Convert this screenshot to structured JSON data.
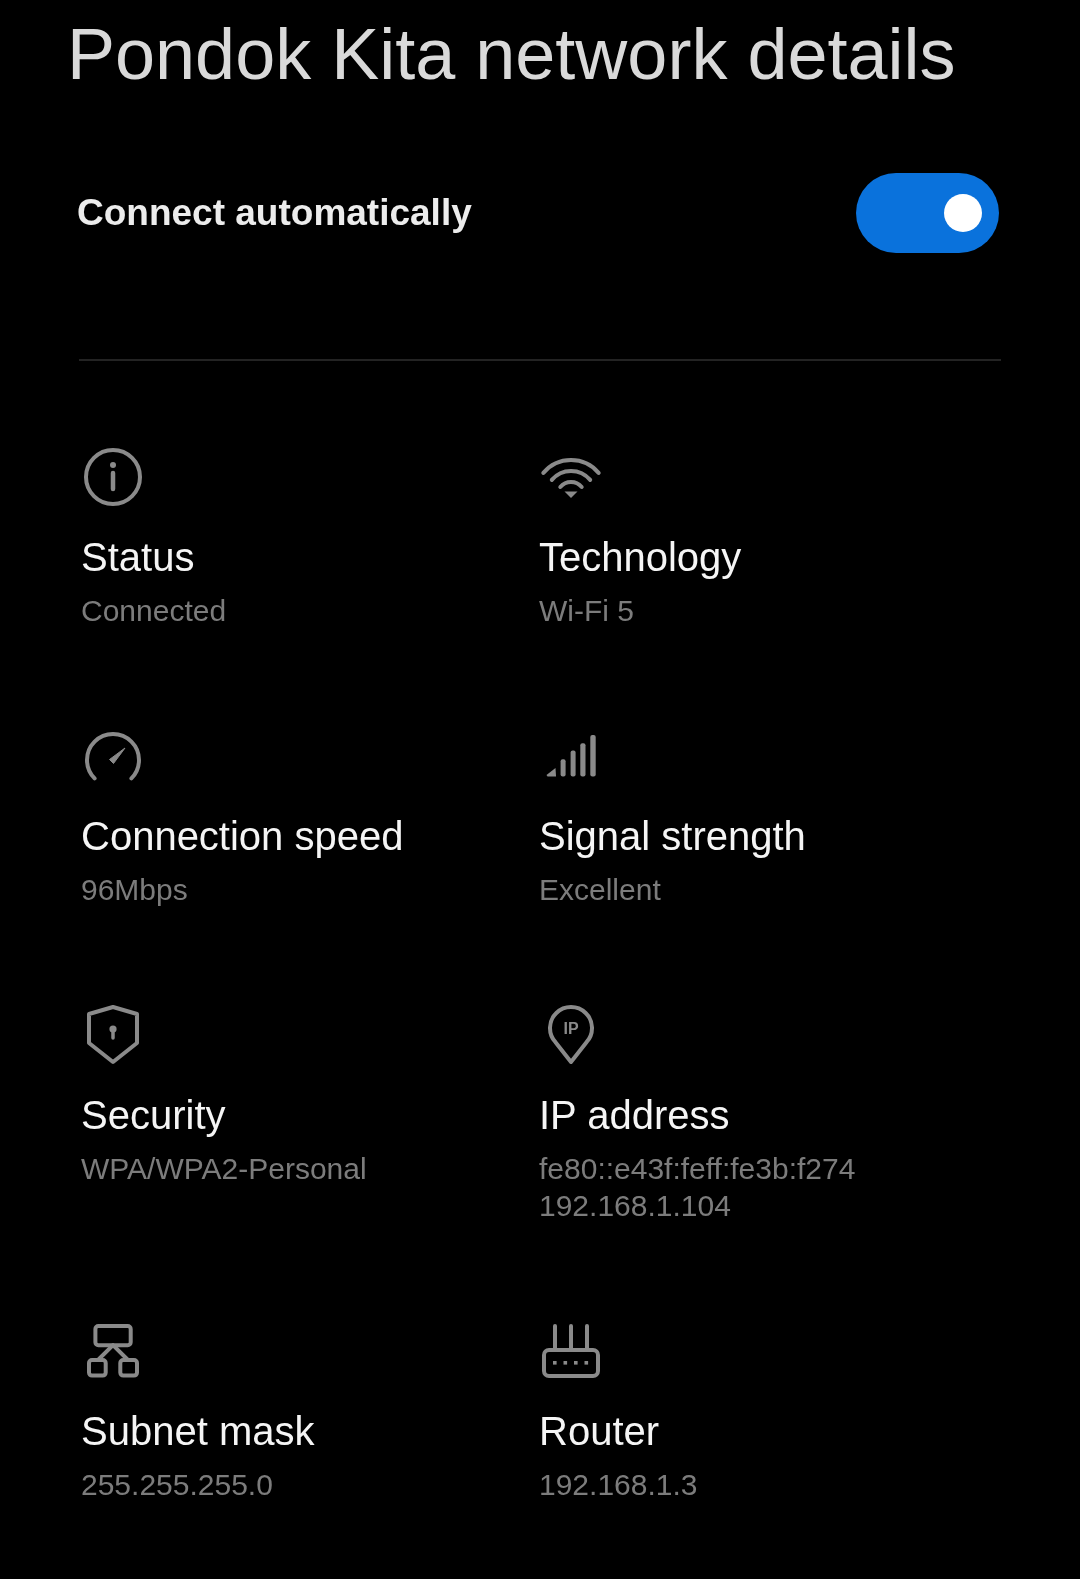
{
  "header": {
    "title": "Pondok Kita network details"
  },
  "connect_automatically": {
    "label": "Connect automatically",
    "on": true
  },
  "detail_rows": [
    {
      "items": [
        {
          "kind": "info",
          "label": "Status",
          "values": [
            "Connected"
          ]
        },
        {
          "kind": "wifi",
          "label": "Technology",
          "values": [
            "Wi-Fi 5"
          ]
        }
      ]
    },
    {
      "items": [
        {
          "kind": "speed",
          "label": "Connection speed",
          "values": [
            "96Mbps"
          ]
        },
        {
          "kind": "signal",
          "label": "Signal strength",
          "values": [
            "Excellent"
          ]
        }
      ]
    },
    {
      "items": [
        {
          "kind": "security",
          "label": "Security",
          "values": [
            "WPA/WPA2-Personal"
          ]
        },
        {
          "kind": "ip",
          "icon_text": "IP",
          "label": "IP address",
          "values": [
            "fe80::e43f:feff:fe3b:f274",
            "192.168.1.104"
          ]
        }
      ]
    },
    {
      "items": [
        {
          "kind": "subnet",
          "label": "Subnet mask",
          "values": [
            "255.255.255.0"
          ]
        },
        {
          "kind": "router",
          "label": "Router",
          "values": [
            "192.168.1.3"
          ]
        }
      ]
    }
  ]
}
